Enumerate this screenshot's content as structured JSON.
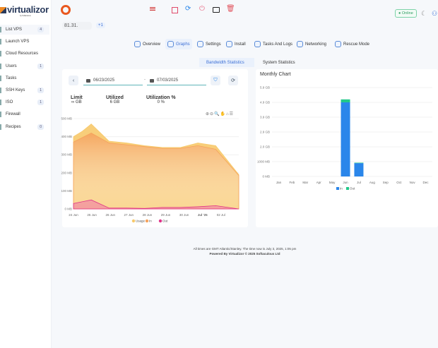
{
  "brand": {
    "name": "virtualizor",
    "tagline": "by Softaculous"
  },
  "sidebar": {
    "items": [
      {
        "label": "List VPS",
        "badge": "4"
      },
      {
        "label": "Launch VPS"
      },
      {
        "label": "Cloud Resources"
      },
      {
        "label": "Users",
        "badge": "1"
      },
      {
        "label": "Tasks"
      },
      {
        "label": "SSH Keys",
        "badge": "1"
      },
      {
        "label": "ISO",
        "badge": "1"
      },
      {
        "label": "Firewall"
      },
      {
        "label": "Recipes",
        "badge": "0"
      }
    ]
  },
  "header": {
    "status": "Online",
    "ip": "81.31.",
    "ip_more": "+1",
    "icons": [
      "ubuntu-icon",
      "us-flag-icon",
      "stop-icon",
      "restart-icon",
      "power-icon",
      "console-icon",
      "delete-icon",
      "moon-icon",
      "user-icon"
    ]
  },
  "tabs": [
    {
      "label": "Overview"
    },
    {
      "label": "Graphs",
      "active": true
    },
    {
      "label": "Settings"
    },
    {
      "label": "Install"
    },
    {
      "label": "Tasks And Logs"
    },
    {
      "label": "Networking"
    },
    {
      "label": "Rescue Mode"
    }
  ],
  "subtabs": [
    {
      "label": "Bandwidth Statistics",
      "active": true
    },
    {
      "label": "System Statistics"
    }
  ],
  "filters": {
    "start_date": "06/23/2025",
    "separator": "-",
    "end_date": "07/03/2025"
  },
  "stats": [
    {
      "label": "Limit",
      "value": "∞ GB"
    },
    {
      "label": "Utilized",
      "value": "6 GB"
    },
    {
      "label": "Utilization %",
      "value": "0 %"
    }
  ],
  "colors": {
    "usage": "#f7c96b",
    "in": "#f5a25c",
    "out": "#e0338a",
    "bar_in": "#2a86ea",
    "bar_out": "#22c98a",
    "accent": "#3b6fd6"
  },
  "chart_data": [
    {
      "type": "area",
      "ylim": [
        0,
        500
      ],
      "yticks": [
        "0 MB",
        "100 MB",
        "200 MB",
        "300 MB",
        "400 MB",
        "500 MB"
      ],
      "xticks": [
        "24 Jun",
        "25 Jun",
        "26 Jun",
        "27 Jun",
        "28 Jun",
        "29 Jun",
        "30 Jun",
        "Jul '25",
        "02 Jul"
      ],
      "x": [
        "24 Jun",
        "24 Jun 12h",
        "25 Jun",
        "26 Jun",
        "27 Jun",
        "28 Jun",
        "29 Jun",
        "30 Jun",
        "01 Jul",
        "02 Jul",
        "03 Jul"
      ],
      "series": [
        {
          "name": "Usage",
          "values": [
            400,
            430,
            470,
            375,
            365,
            350,
            340,
            340,
            365,
            350,
            190
          ]
        },
        {
          "name": "In",
          "values": [
            370,
            395,
            420,
            365,
            355,
            345,
            335,
            335,
            350,
            330,
            185
          ]
        },
        {
          "name": "Out",
          "values": [
            30,
            40,
            50,
            5,
            5,
            3,
            8,
            8,
            12,
            18,
            0
          ]
        }
      ],
      "legend": "bottom"
    },
    {
      "type": "bar",
      "stacked": true,
      "title": "Monthly Chart",
      "ylim": [
        0,
        6000
      ],
      "yunit": "MB",
      "yticks": [
        "0 MB",
        "1000 MB",
        "2.0 GB",
        "2.9 GB",
        "3.9 GB",
        "4.9 GB",
        "5.9 GB"
      ],
      "categories": [
        "Jan",
        "Feb",
        "Mar",
        "Apr",
        "May",
        "Jun",
        "Jul",
        "Aug",
        "Sep",
        "Oct",
        "Nov",
        "Dec"
      ],
      "series": [
        {
          "name": "In",
          "values": [
            0,
            0,
            0,
            0,
            0,
            5000,
            900,
            0,
            0,
            0,
            0,
            0
          ]
        },
        {
          "name": "Out",
          "values": [
            0,
            0,
            0,
            0,
            0,
            200,
            30,
            0,
            0,
            0,
            0,
            0
          ]
        }
      ],
      "legend": "bottom"
    }
  ],
  "footer": {
    "timezone": "All times are GMT Atlantic/Stanley. The time now is July 3, 2025, 1:05 pm",
    "powered": "Powered By Virtualizor © 2025 Softaculous Ltd"
  }
}
